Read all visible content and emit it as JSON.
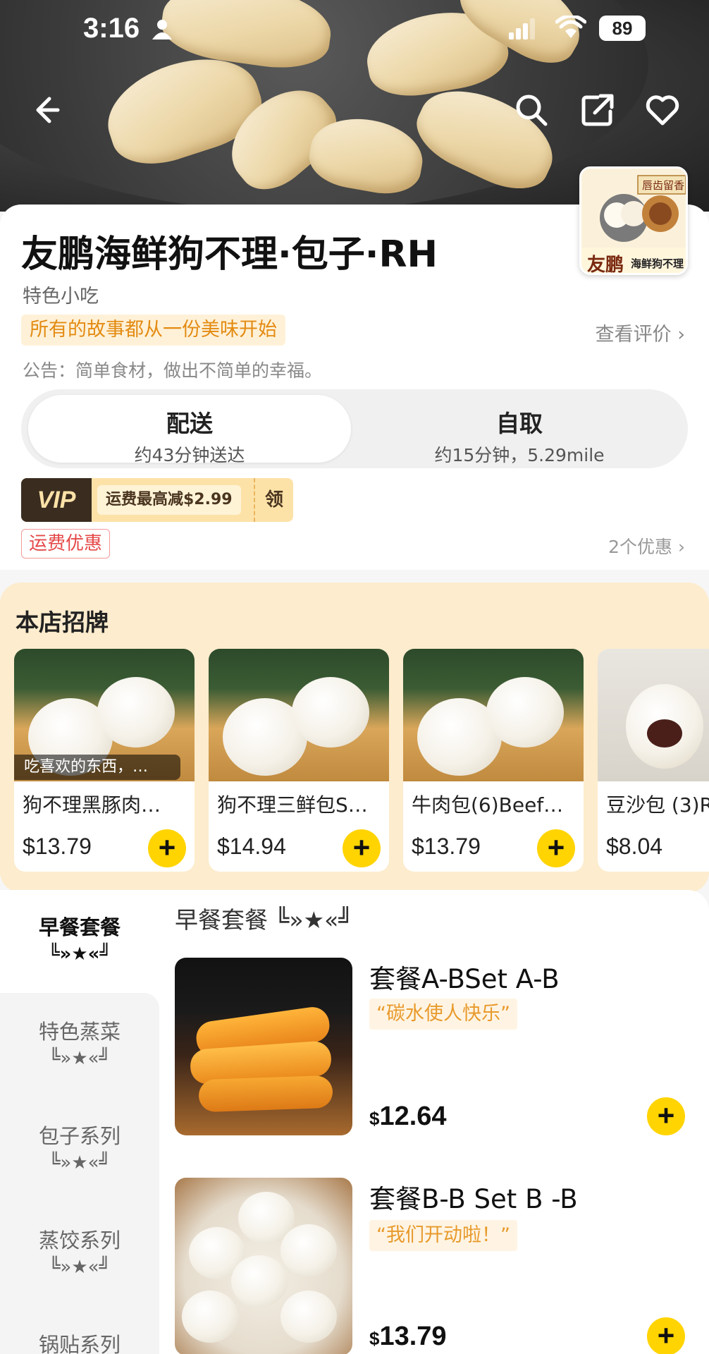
{
  "status": {
    "time": "3:16",
    "battery": "89"
  },
  "nav": {
    "back": "back",
    "search": "search",
    "share": "share",
    "favorite": "favorite"
  },
  "shop": {
    "name": "友鹏海鲜狗不理·包子·RH",
    "category": "特色小吃",
    "slogan": "所有的故事都从一份美味开始",
    "reviews": "查看评价 ›",
    "notice": "公告：简单食材，做出不简单的幸福。",
    "logo_text": "友鹏",
    "logo_sub": "海鲜狗不理",
    "logo_tag": "唇齿留香"
  },
  "fulfillment": [
    {
      "label": "配送",
      "sub": "约43分钟送达",
      "active": true
    },
    {
      "label": "自取",
      "sub": "约15分钟，5.29mile",
      "active": false
    }
  ],
  "vip": {
    "badge": "VIP",
    "amount": "运费最高减$2.99",
    "claim": "领"
  },
  "promo": {
    "tag": "运费优惠",
    "count": "2个优惠 ›"
  },
  "signature": {
    "title": "本店招牌",
    "items": [
      {
        "name": "狗不理黑豚肉…",
        "price": "$13.79",
        "overlay": "吃喜欢的东西，…"
      },
      {
        "name": "狗不理三鲜包S…",
        "price": "$14.94"
      },
      {
        "name": "牛肉包(6)Beef…",
        "price": "$13.79"
      },
      {
        "name": "豆沙包 (3)R",
        "price": "$8.04"
      }
    ]
  },
  "categories": [
    {
      "name": "早餐套餐",
      "deco": "╚»★«╝",
      "active": true
    },
    {
      "name": "特色蒸菜",
      "deco": "╚»★«╝",
      "active": false
    },
    {
      "name": "包子系列",
      "deco": "╚»★«╝",
      "active": false
    },
    {
      "name": "蒸饺系列",
      "deco": "╚»★«╝",
      "active": false
    },
    {
      "name": "锅贴系列",
      "deco": "",
      "active": false
    }
  ],
  "section": {
    "title": "早餐套餐 ╚»★«╝"
  },
  "menu_items": [
    {
      "name": "套餐A-BSet A-B",
      "tag": "“碳水使人快乐”",
      "currency": "$",
      "price": "12.64"
    },
    {
      "name": "套餐B-B Set B -B",
      "tag": "“我们开动啦！”",
      "currency": "$",
      "price": "13.79"
    }
  ],
  "colors": {
    "accent": "#ffd400",
    "slogan": "#e38b12",
    "promo_red": "#e54848",
    "signature_bg": "#fdeccd"
  }
}
